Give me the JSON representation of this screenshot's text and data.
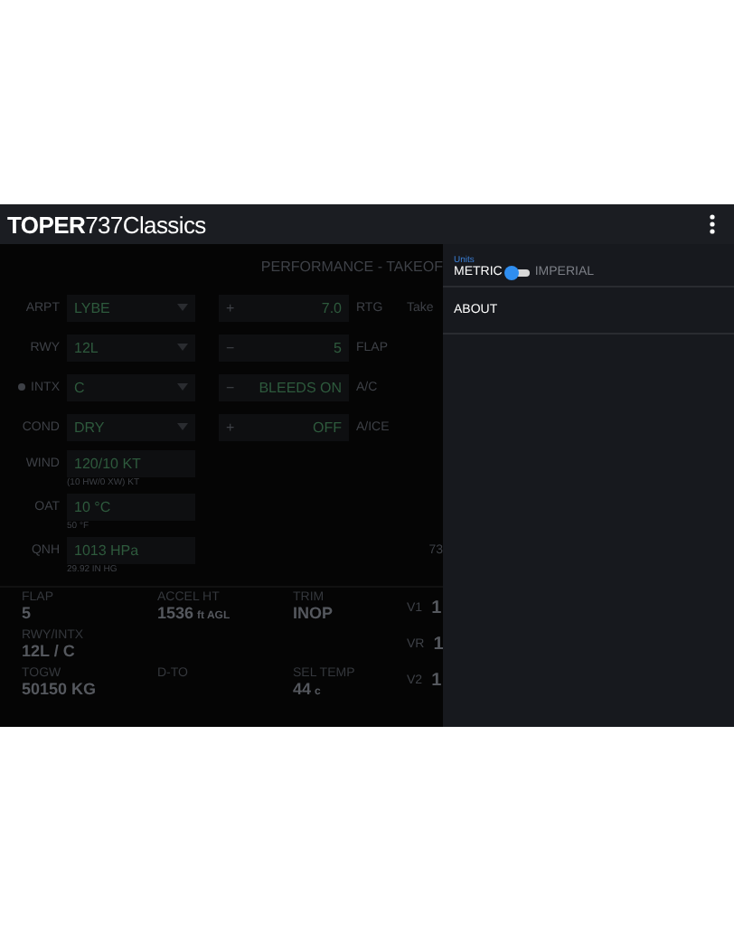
{
  "app_bar": {
    "brand_bold": "TOPER",
    "brand_rest": "737Classics"
  },
  "page_title": "PERFORMANCE - TAKEOF",
  "inputs": [
    {
      "label": "ARPT",
      "flagged": false,
      "select": "LYBE",
      "sign": "+",
      "stepper": "7.0",
      "side_label": "RTG",
      "extra": "Take"
    },
    {
      "label": "RWY",
      "flagged": false,
      "select": "12L",
      "sign": "−",
      "stepper": "5",
      "side_label": "FLAP"
    },
    {
      "label": "INTX",
      "flagged": true,
      "select": "C",
      "sign": "−",
      "stepper": "BLEEDS ON",
      "side_label": "A/C"
    },
    {
      "label": "COND",
      "flagged": false,
      "select": "DRY",
      "sign": "+",
      "stepper": "OFF",
      "side_label": "A/ICE"
    }
  ],
  "environment": [
    {
      "label": "WIND",
      "value": "120/10 KT",
      "note": "(10 HW/0 XW) KT"
    },
    {
      "label": "OAT",
      "value": "10 °C",
      "note": "50 °F"
    },
    {
      "label": "QNH",
      "value": "1013 HPa",
      "note": "29.92 IN HG",
      "side": "73"
    }
  ],
  "results": [
    [
      {
        "label": "FLAP",
        "value": "5"
      },
      {
        "label": "ACCEL HT",
        "value": "1536",
        "unit": "ft AGL"
      },
      {
        "label": "TRIM",
        "value": "INOP"
      }
    ],
    [
      {
        "label": "RWY/INTX",
        "value": "12L / C"
      }
    ],
    [
      {
        "label": "TOGW",
        "value": "50150 KG"
      },
      {
        "label": "D-TO"
      },
      {
        "label": "SEL TEMP",
        "value": "44",
        "unit": "c"
      }
    ]
  ],
  "speeds": [
    {
      "label": "V1",
      "value": "1"
    },
    {
      "label": "VR",
      "value": "1"
    },
    {
      "label": "V2",
      "value": "1"
    }
  ],
  "drawer": {
    "section": "Units",
    "left": "METRIC",
    "right": "IMPERIAL",
    "on": false,
    "items": [
      "ABOUT"
    ]
  }
}
